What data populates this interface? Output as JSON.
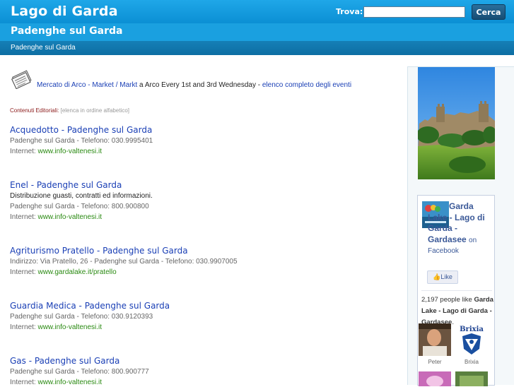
{
  "header": {
    "site_title": "Lago di Garda",
    "search_label": "Trova:",
    "search_value": "",
    "search_button": "Cerca",
    "sub_title": "Padenghe sul Garda",
    "breadcrumb": "Padenghe sul Garda"
  },
  "news": {
    "event_link": "Mercato di Arco - Market / Markt",
    "event_text": " a Arco Every 1st and 3rd Wednesday - ",
    "all_events_link": "elenco completo degli eventi"
  },
  "editorial": {
    "label": "Contenuti Editoriali:",
    "note": " [elenca in ordine alfabetico]"
  },
  "entries": [
    {
      "title": "Acquedotto - Padenghe sul Garda",
      "lines": [
        "Padenghe sul Garda - Telefono: 030.9995401"
      ],
      "internet_label": "Internet: ",
      "url": "www.info-valtenesi.it"
    },
    {
      "title": "Enel - Padenghe sul Garda",
      "description": "Distribuzione guasti, contratti ed informazioni.",
      "lines": [
        "Padenghe sul Garda - Telefono: 800.900800"
      ],
      "internet_label": "Internet: ",
      "url": "www.info-valtenesi.it"
    },
    {
      "title": "Agriturismo Pratello - Padenghe sul Garda",
      "lines": [
        "Indirizzo: Via Pratello, 26 - Padenghe sul Garda - Telefono: 030.9907005"
      ],
      "internet_label": "Internet: ",
      "url": "www.gardalake.it/pratello"
    },
    {
      "title": "Guardia Medica - Padenghe sul Garda",
      "lines": [
        "Padenghe sul Garda - Telefono: 030.9120393"
      ],
      "internet_label": "Internet: ",
      "url": "www.info-valtenesi.it"
    },
    {
      "title": "Gas - Padenghe sul Garda",
      "lines": [
        "Padenghe sul Garda - Telefono: 800.900777"
      ],
      "internet_label": "Internet: ",
      "url": "www.info-valtenesi.it"
    }
  ],
  "facebook": {
    "page_name": "Garda Lake - Lago di Garda - Gardasee",
    "on_label": "on",
    "fb_label": "Facebook",
    "like_button": "Like",
    "count_text": "2,197 people like",
    "count_page": "Garda Lake - Lago di Garda - Gardasee",
    "count_suffix": ".",
    "fans": [
      {
        "name": "Peter"
      },
      {
        "name": "Brixia"
      }
    ],
    "brixia_logo_text": "Brixia"
  },
  "colors": {
    "header_blue": "#1aa0e0",
    "link_blue": "#1a3fb5",
    "url_green": "#2a8a12",
    "facebook_blue": "#3b5998"
  }
}
